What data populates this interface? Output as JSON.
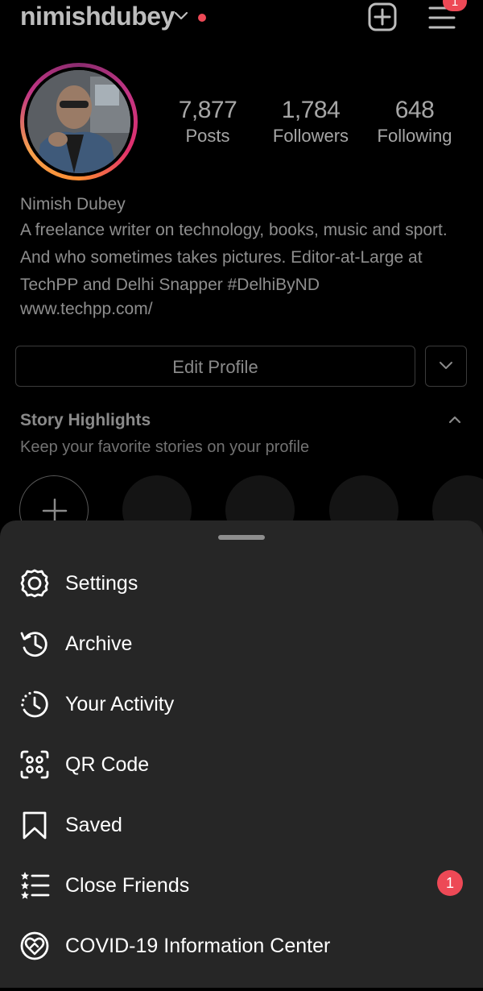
{
  "header": {
    "username": "nimishdubey",
    "menu_badge_count": "1"
  },
  "profile": {
    "stats": [
      {
        "value": "7,877",
        "label": "Posts"
      },
      {
        "value": "1,784",
        "label": "Followers"
      },
      {
        "value": "648",
        "label": "Following"
      }
    ],
    "name": "Nimish Dubey",
    "bio_line1": "A freelance writer on technology, books, music and sport.",
    "bio_line2": "And who sometimes takes pictures. Editor-at-Large at",
    "bio_line3": "TechPP and Delhi Snapper #DelhiByND",
    "website": "www.techpp.com/",
    "edit_profile_label": "Edit Profile"
  },
  "highlights": {
    "title": "Story Highlights",
    "subtitle": "Keep your favorite stories on your profile"
  },
  "menu": {
    "items": [
      {
        "label": "Settings",
        "icon": "gear-icon"
      },
      {
        "label": "Archive",
        "icon": "archive-icon"
      },
      {
        "label": "Your Activity",
        "icon": "activity-icon"
      },
      {
        "label": "QR Code",
        "icon": "qr-code-icon"
      },
      {
        "label": "Saved",
        "icon": "bookmark-icon"
      },
      {
        "label": "Close Friends",
        "icon": "close-friends-icon",
        "badge": "1"
      },
      {
        "label": "COVID-19 Information Center",
        "icon": "covid-info-icon"
      }
    ]
  },
  "colors": {
    "accent_red": "#ed4956",
    "sheet_bg": "#262626",
    "page_bg": "#000000"
  }
}
